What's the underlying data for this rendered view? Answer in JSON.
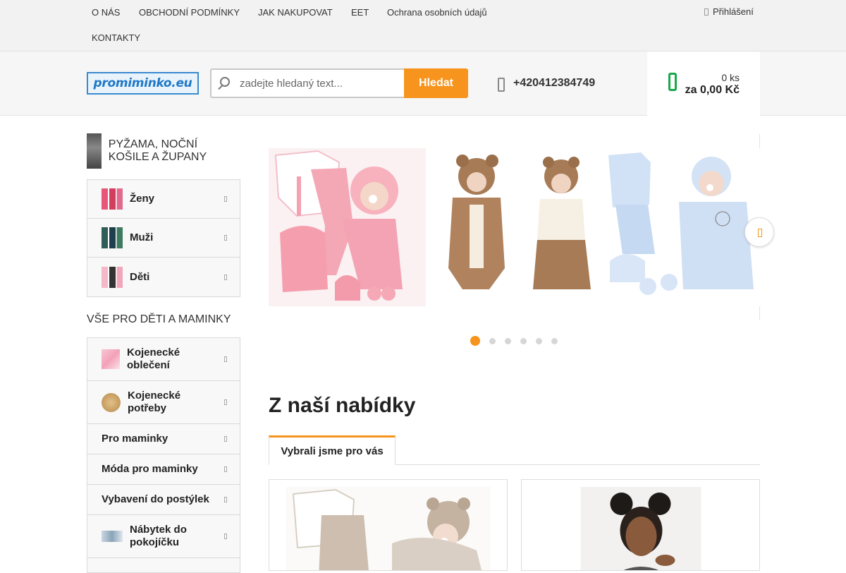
{
  "topnav": {
    "links": [
      "O NÁS",
      "OBCHODNÍ PODMÍNKY",
      "JAK NAKUPOVAT",
      "EET",
      "Ochrana osobních údajů",
      "KONTAKTY"
    ],
    "login": "Přihlášení"
  },
  "header": {
    "logo_text": "promiminko.eu",
    "search_placeholder": "zadejte hledaný text...",
    "search_button": "Hledat",
    "phone": "+420412384749",
    "cart_qty": "0 ks",
    "cart_sum": "za 0,00 Kč"
  },
  "sidebar": {
    "category_title": "PYŽAMA, NOČNÍ KOŠILE A ŽUPANY",
    "menu1": [
      {
        "label": "Ženy"
      },
      {
        "label": "Muži"
      },
      {
        "label": "Děti"
      }
    ],
    "section_title": "VŠE PRO DĚTI A MAMINKY",
    "menu2": [
      {
        "label": "Kojenecké oblečení"
      },
      {
        "label": "Kojenecké potřeby"
      },
      {
        "label": "Pro maminky"
      },
      {
        "label": "Móda pro maminky"
      },
      {
        "label": "Vybavení do postýlek"
      },
      {
        "label": "Nábytek do pokojíčku"
      }
    ]
  },
  "slider": {
    "active_dot": 1,
    "dot_count": 6
  },
  "offers": {
    "heading": "Z naší nabídky",
    "tab": "Vybrali jsme pro vás"
  },
  "colors": {
    "accent": "#f7941d",
    "cart_icon": "#19a84a",
    "logo": "#1e78c8"
  }
}
